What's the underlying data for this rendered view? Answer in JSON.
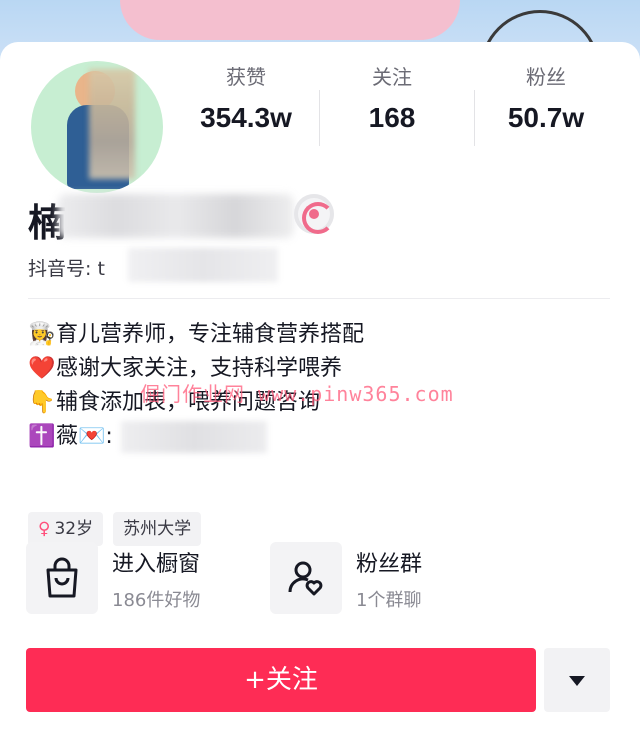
{
  "stats": [
    {
      "label": "获赞",
      "value": "354.3w"
    },
    {
      "label": "关注",
      "value": "168"
    },
    {
      "label": "粉丝",
      "value": "50.7w"
    }
  ],
  "profile": {
    "name_visible": "楠",
    "douyin_id_label": "抖音号: t"
  },
  "bio": [
    {
      "emoji": "👩‍🍳",
      "text": "育儿营养师，专注辅食营养搭配"
    },
    {
      "emoji": "❤️",
      "text": "感谢大家关注，支持科学喂养"
    },
    {
      "emoji": "👇",
      "text": "辅食添加表，喂养问题咨询"
    },
    {
      "emoji": "✝️",
      "text": "薇💌:"
    }
  ],
  "watermark": "倔门作业网 www.pinw365.com",
  "tags": {
    "gender_symbol": "♀",
    "age": "32岁",
    "school": "苏州大学"
  },
  "shortcuts": {
    "store": {
      "title": "进入橱窗",
      "subtitle": "186件好物",
      "icon": "shopping-bag-icon"
    },
    "fan_group": {
      "title": "粉丝群",
      "subtitle": "1个群聊",
      "icon": "fan-group-icon"
    }
  },
  "actions": {
    "follow_label": "+关注",
    "more_icon": "caret-down-icon"
  },
  "colors": {
    "accent": "#fe2c55",
    "text": "#161823",
    "muted": "#8a8a93"
  }
}
